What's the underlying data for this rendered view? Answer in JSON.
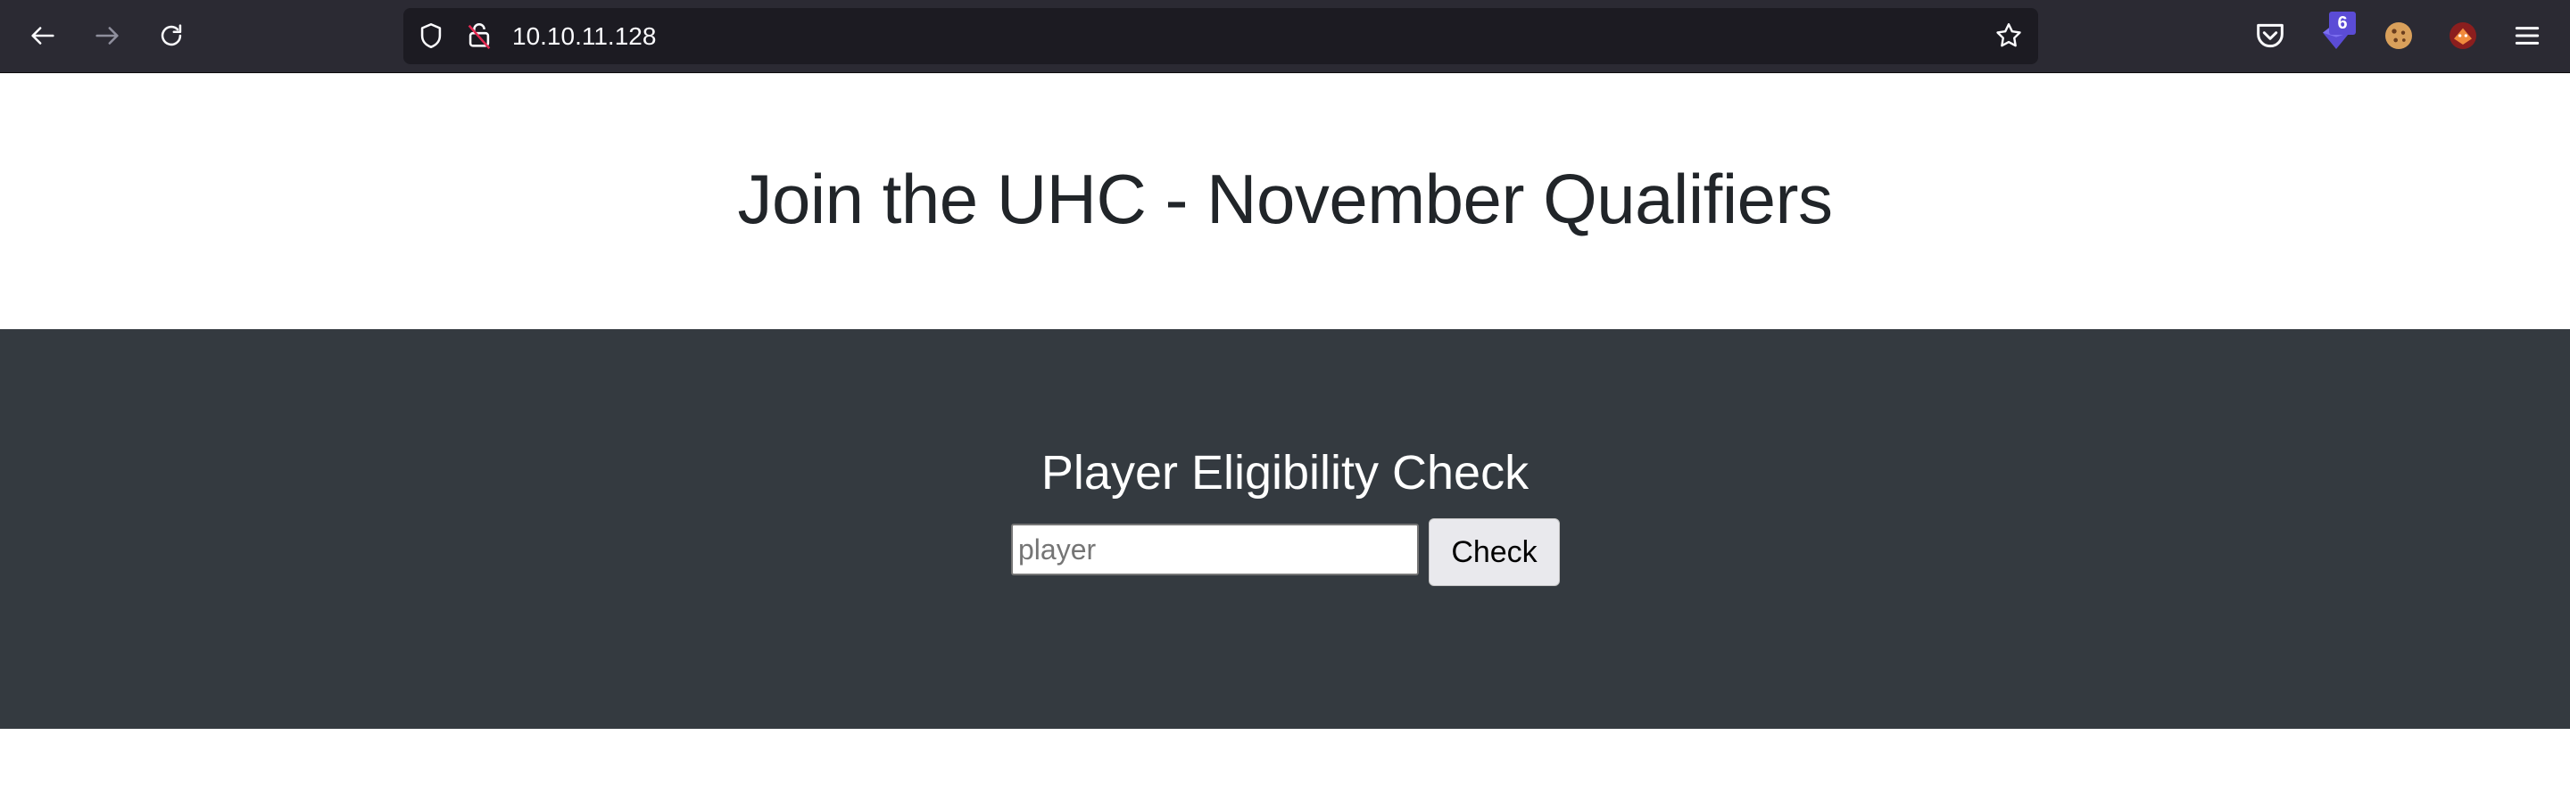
{
  "browser": {
    "url": "10.10.11.128",
    "extension_badge_count": "6",
    "icons": [
      "back-arrow-icon",
      "forward-arrow-icon",
      "reload-icon",
      "shield-icon",
      "insecure-lock-icon",
      "star-icon",
      "pocket-icon",
      "ublock-icon",
      "cookie-icon",
      "foxyproxy-icon",
      "hamburger-menu-icon"
    ]
  },
  "page": {
    "title": "Join the UHC - November Qualifiers",
    "form": {
      "heading": "Player Eligibility Check",
      "input_value": "",
      "input_placeholder": "player",
      "button_label": "Check"
    }
  },
  "colors": {
    "chrome_bg": "#2b2a33",
    "urlbar_bg": "#1c1b22",
    "dark_section_bg": "#343a40",
    "heading_text": "#212529"
  }
}
